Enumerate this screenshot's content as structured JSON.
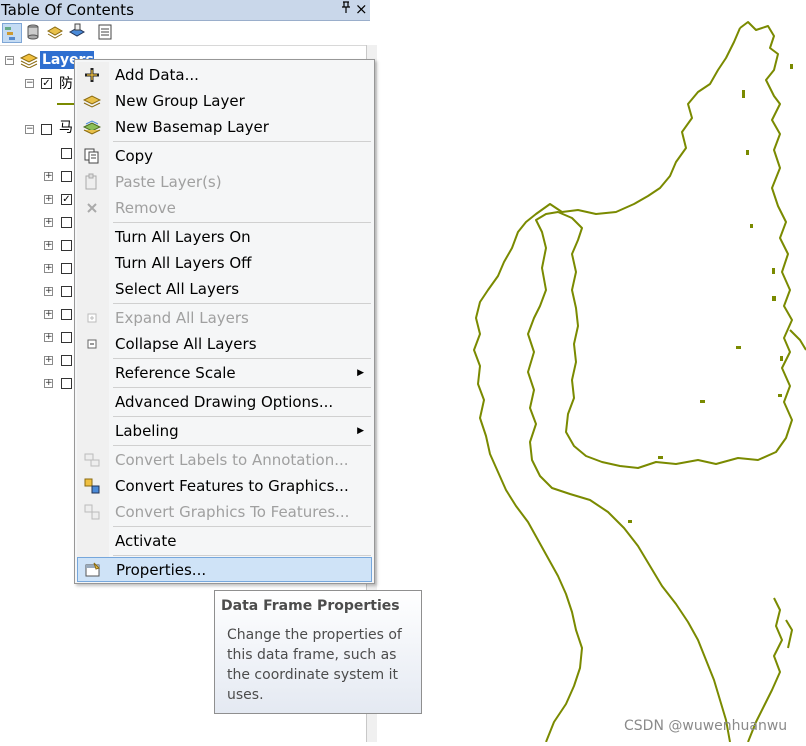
{
  "toc": {
    "title": "Table Of Contents",
    "pin_glyph": "ᅲ",
    "close_glyph": "×",
    "toolbar": [
      "list-by-drawing-order-icon",
      "list-by-source-icon",
      "list-by-visibility-icon",
      "list-by-selection-icon",
      "options-icon"
    ],
    "root_label": "Layers",
    "group1_label": "防",
    "group2_label": "马"
  },
  "menu": {
    "items": [
      {
        "label": "Add Data...",
        "icon": "add-data-icon",
        "disabled": false
      },
      {
        "label": "New Group Layer",
        "icon": "group-layer-icon",
        "disabled": false
      },
      {
        "label": "New Basemap Layer",
        "icon": "basemap-layer-icon",
        "disabled": false
      },
      {
        "label": "Copy",
        "icon": "copy-icon",
        "disabled": false
      },
      {
        "label": "Paste Layer(s)",
        "icon": "paste-icon",
        "disabled": true
      },
      {
        "label": "Remove",
        "icon": "remove-icon",
        "disabled": true
      },
      {
        "label": "Turn All Layers On",
        "icon": "",
        "disabled": false
      },
      {
        "label": "Turn All Layers Off",
        "icon": "",
        "disabled": false
      },
      {
        "label": "Select All Layers",
        "icon": "",
        "disabled": false
      },
      {
        "label": "Expand All Layers",
        "icon": "expand-icon",
        "disabled": true
      },
      {
        "label": "Collapse All Layers",
        "icon": "collapse-icon",
        "disabled": false
      },
      {
        "label": "Reference Scale",
        "icon": "",
        "disabled": false,
        "submenu": true
      },
      {
        "label": "Advanced Drawing Options...",
        "icon": "",
        "disabled": false
      },
      {
        "label": "Labeling",
        "icon": "",
        "disabled": false,
        "submenu": true
      },
      {
        "label": "Convert Labels to Annotation...",
        "icon": "convert-labels-icon",
        "disabled": true
      },
      {
        "label": "Convert Features to Graphics...",
        "icon": "convert-features-icon",
        "disabled": false
      },
      {
        "label": "Convert Graphics To Features...",
        "icon": "convert-graphics-icon",
        "disabled": true
      },
      {
        "label": "Activate",
        "icon": "",
        "disabled": false
      },
      {
        "label": "Properties...",
        "icon": "properties-icon",
        "disabled": false,
        "highlighted": true
      }
    ],
    "submenu_arrow": "▶"
  },
  "tooltip": {
    "title": "Data Frame Properties",
    "body": "Change the properties of this data frame, such as the coordinate system it uses."
  },
  "map": {
    "line_color": "#7a8a00"
  },
  "watermark": "CSDN @wuwenhuanwu"
}
